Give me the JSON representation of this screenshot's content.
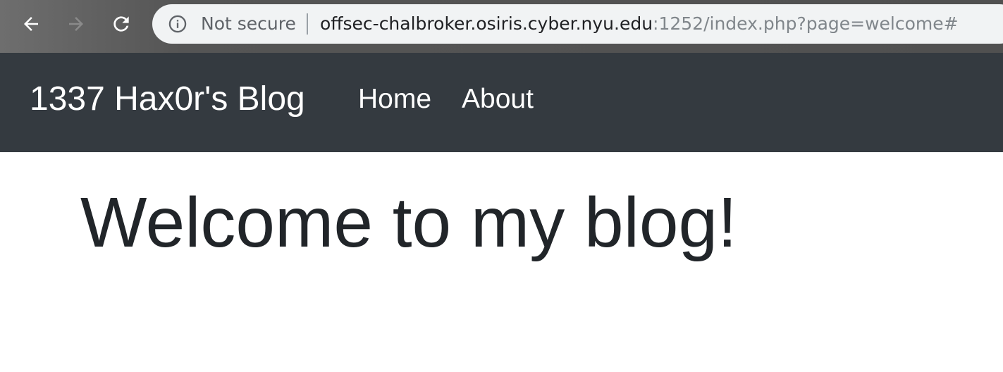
{
  "browser": {
    "security_label": "Not secure",
    "url_host": "offsec-chalbroker.osiris.cyber.nyu.edu",
    "url_rest": ":1252/index.php?page=welcome#"
  },
  "site": {
    "brand": "1337 Hax0r's Blog",
    "nav_items": [
      {
        "label": "Home"
      },
      {
        "label": "About"
      }
    ]
  },
  "main": {
    "heading": "Welcome to my blog!"
  }
}
